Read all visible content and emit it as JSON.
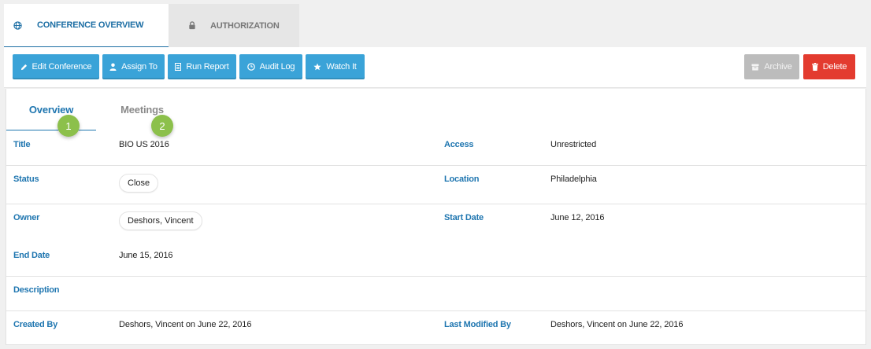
{
  "top_tabs": [
    {
      "label": "CONFERENCE OVERVIEW",
      "icon": "globe-icon",
      "active": true
    },
    {
      "label": "AUTHORIZATION",
      "icon": "lock-icon",
      "active": false
    }
  ],
  "toolbar": {
    "edit_label": "Edit Conference",
    "assign_label": "Assign To",
    "report_label": "Run Report",
    "audit_label": "Audit Log",
    "watch_label": "Watch It",
    "archive_label": "Archive",
    "delete_label": "Delete"
  },
  "subtabs": {
    "overview_label": "Overview",
    "meetings_label": "Meetings",
    "badge_1": "1",
    "badge_2": "2"
  },
  "fields": {
    "title_label": "Title",
    "title_value": "BIO US 2016",
    "access_label": "Access",
    "access_value": "Unrestricted",
    "status_label": "Status",
    "status_value": "Close",
    "location_label": "Location",
    "location_value": "Philadelphia",
    "owner_label": "Owner",
    "owner_value": "Deshors, Vincent",
    "start_label": "Start Date",
    "start_value": "June 12, 2016",
    "end_label": "End Date",
    "end_value": "June 15, 2016",
    "description_label": "Description",
    "created_label": "Created By",
    "created_value": "Deshors, Vincent on June 22, 2016",
    "modified_label": "Last Modified By",
    "modified_value": "Deshors, Vincent on June 22, 2016"
  },
  "colors": {
    "accent": "#1f76b0",
    "button_blue": "#3aa3d8",
    "button_grey": "#bcbcbc",
    "button_red": "#e33b2f",
    "badge_green": "#8cc04b"
  }
}
